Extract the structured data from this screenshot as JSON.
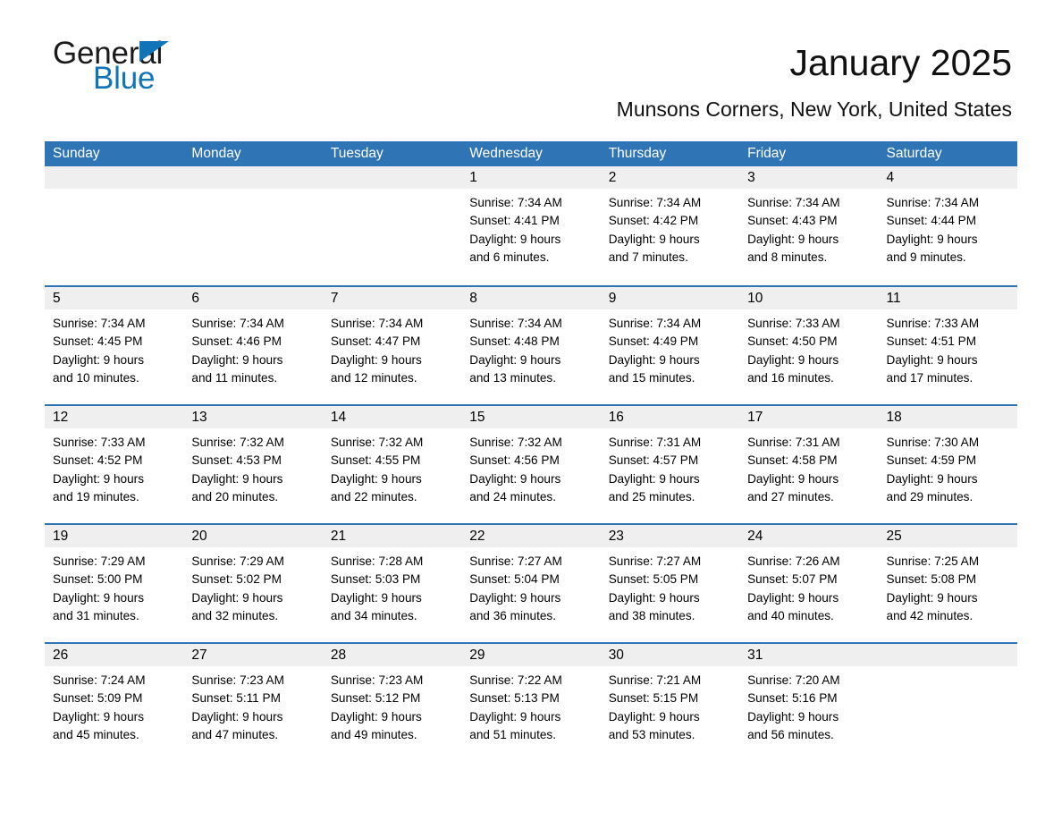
{
  "brand": {
    "name_part1": "General",
    "name_part2": "Blue",
    "triangle_color": "#1274b8"
  },
  "header": {
    "title": "January 2025",
    "subtitle": "Munsons Corners, New York, United States"
  },
  "colors": {
    "header_blue": "#2f75b5",
    "day_band_grey": "#efefef",
    "cell_white": "#ffffff"
  },
  "weekdays": [
    "Sunday",
    "Monday",
    "Tuesday",
    "Wednesday",
    "Thursday",
    "Friday",
    "Saturday"
  ],
  "weeks": [
    [
      {
        "day": "",
        "empty": true
      },
      {
        "day": "",
        "empty": true
      },
      {
        "day": "",
        "empty": true
      },
      {
        "day": "1",
        "sunrise": "Sunrise: 7:34 AM",
        "sunset": "Sunset: 4:41 PM",
        "daylight1": "Daylight: 9 hours",
        "daylight2": "and 6 minutes."
      },
      {
        "day": "2",
        "sunrise": "Sunrise: 7:34 AM",
        "sunset": "Sunset: 4:42 PM",
        "daylight1": "Daylight: 9 hours",
        "daylight2": "and 7 minutes."
      },
      {
        "day": "3",
        "sunrise": "Sunrise: 7:34 AM",
        "sunset": "Sunset: 4:43 PM",
        "daylight1": "Daylight: 9 hours",
        "daylight2": "and 8 minutes."
      },
      {
        "day": "4",
        "sunrise": "Sunrise: 7:34 AM",
        "sunset": "Sunset: 4:44 PM",
        "daylight1": "Daylight: 9 hours",
        "daylight2": "and 9 minutes."
      }
    ],
    [
      {
        "day": "5",
        "sunrise": "Sunrise: 7:34 AM",
        "sunset": "Sunset: 4:45 PM",
        "daylight1": "Daylight: 9 hours",
        "daylight2": "and 10 minutes."
      },
      {
        "day": "6",
        "sunrise": "Sunrise: 7:34 AM",
        "sunset": "Sunset: 4:46 PM",
        "daylight1": "Daylight: 9 hours",
        "daylight2": "and 11 minutes."
      },
      {
        "day": "7",
        "sunrise": "Sunrise: 7:34 AM",
        "sunset": "Sunset: 4:47 PM",
        "daylight1": "Daylight: 9 hours",
        "daylight2": "and 12 minutes."
      },
      {
        "day": "8",
        "sunrise": "Sunrise: 7:34 AM",
        "sunset": "Sunset: 4:48 PM",
        "daylight1": "Daylight: 9 hours",
        "daylight2": "and 13 minutes."
      },
      {
        "day": "9",
        "sunrise": "Sunrise: 7:34 AM",
        "sunset": "Sunset: 4:49 PM",
        "daylight1": "Daylight: 9 hours",
        "daylight2": "and 15 minutes."
      },
      {
        "day": "10",
        "sunrise": "Sunrise: 7:33 AM",
        "sunset": "Sunset: 4:50 PM",
        "daylight1": "Daylight: 9 hours",
        "daylight2": "and 16 minutes."
      },
      {
        "day": "11",
        "sunrise": "Sunrise: 7:33 AM",
        "sunset": "Sunset: 4:51 PM",
        "daylight1": "Daylight: 9 hours",
        "daylight2": "and 17 minutes."
      }
    ],
    [
      {
        "day": "12",
        "sunrise": "Sunrise: 7:33 AM",
        "sunset": "Sunset: 4:52 PM",
        "daylight1": "Daylight: 9 hours",
        "daylight2": "and 19 minutes."
      },
      {
        "day": "13",
        "sunrise": "Sunrise: 7:32 AM",
        "sunset": "Sunset: 4:53 PM",
        "daylight1": "Daylight: 9 hours",
        "daylight2": "and 20 minutes."
      },
      {
        "day": "14",
        "sunrise": "Sunrise: 7:32 AM",
        "sunset": "Sunset: 4:55 PM",
        "daylight1": "Daylight: 9 hours",
        "daylight2": "and 22 minutes."
      },
      {
        "day": "15",
        "sunrise": "Sunrise: 7:32 AM",
        "sunset": "Sunset: 4:56 PM",
        "daylight1": "Daylight: 9 hours",
        "daylight2": "and 24 minutes."
      },
      {
        "day": "16",
        "sunrise": "Sunrise: 7:31 AM",
        "sunset": "Sunset: 4:57 PM",
        "daylight1": "Daylight: 9 hours",
        "daylight2": "and 25 minutes."
      },
      {
        "day": "17",
        "sunrise": "Sunrise: 7:31 AM",
        "sunset": "Sunset: 4:58 PM",
        "daylight1": "Daylight: 9 hours",
        "daylight2": "and 27 minutes."
      },
      {
        "day": "18",
        "sunrise": "Sunrise: 7:30 AM",
        "sunset": "Sunset: 4:59 PM",
        "daylight1": "Daylight: 9 hours",
        "daylight2": "and 29 minutes."
      }
    ],
    [
      {
        "day": "19",
        "sunrise": "Sunrise: 7:29 AM",
        "sunset": "Sunset: 5:00 PM",
        "daylight1": "Daylight: 9 hours",
        "daylight2": "and 31 minutes."
      },
      {
        "day": "20",
        "sunrise": "Sunrise: 7:29 AM",
        "sunset": "Sunset: 5:02 PM",
        "daylight1": "Daylight: 9 hours",
        "daylight2": "and 32 minutes."
      },
      {
        "day": "21",
        "sunrise": "Sunrise: 7:28 AM",
        "sunset": "Sunset: 5:03 PM",
        "daylight1": "Daylight: 9 hours",
        "daylight2": "and 34 minutes."
      },
      {
        "day": "22",
        "sunrise": "Sunrise: 7:27 AM",
        "sunset": "Sunset: 5:04 PM",
        "daylight1": "Daylight: 9 hours",
        "daylight2": "and 36 minutes."
      },
      {
        "day": "23",
        "sunrise": "Sunrise: 7:27 AM",
        "sunset": "Sunset: 5:05 PM",
        "daylight1": "Daylight: 9 hours",
        "daylight2": "and 38 minutes."
      },
      {
        "day": "24",
        "sunrise": "Sunrise: 7:26 AM",
        "sunset": "Sunset: 5:07 PM",
        "daylight1": "Daylight: 9 hours",
        "daylight2": "and 40 minutes."
      },
      {
        "day": "25",
        "sunrise": "Sunrise: 7:25 AM",
        "sunset": "Sunset: 5:08 PM",
        "daylight1": "Daylight: 9 hours",
        "daylight2": "and 42 minutes."
      }
    ],
    [
      {
        "day": "26",
        "sunrise": "Sunrise: 7:24 AM",
        "sunset": "Sunset: 5:09 PM",
        "daylight1": "Daylight: 9 hours",
        "daylight2": "and 45 minutes."
      },
      {
        "day": "27",
        "sunrise": "Sunrise: 7:23 AM",
        "sunset": "Sunset: 5:11 PM",
        "daylight1": "Daylight: 9 hours",
        "daylight2": "and 47 minutes."
      },
      {
        "day": "28",
        "sunrise": "Sunrise: 7:23 AM",
        "sunset": "Sunset: 5:12 PM",
        "daylight1": "Daylight: 9 hours",
        "daylight2": "and 49 minutes."
      },
      {
        "day": "29",
        "sunrise": "Sunrise: 7:22 AM",
        "sunset": "Sunset: 5:13 PM",
        "daylight1": "Daylight: 9 hours",
        "daylight2": "and 51 minutes."
      },
      {
        "day": "30",
        "sunrise": "Sunrise: 7:21 AM",
        "sunset": "Sunset: 5:15 PM",
        "daylight1": "Daylight: 9 hours",
        "daylight2": "and 53 minutes."
      },
      {
        "day": "31",
        "sunrise": "Sunrise: 7:20 AM",
        "sunset": "Sunset: 5:16 PM",
        "daylight1": "Daylight: 9 hours",
        "daylight2": "and 56 minutes."
      },
      {
        "day": "",
        "empty": true
      }
    ]
  ]
}
